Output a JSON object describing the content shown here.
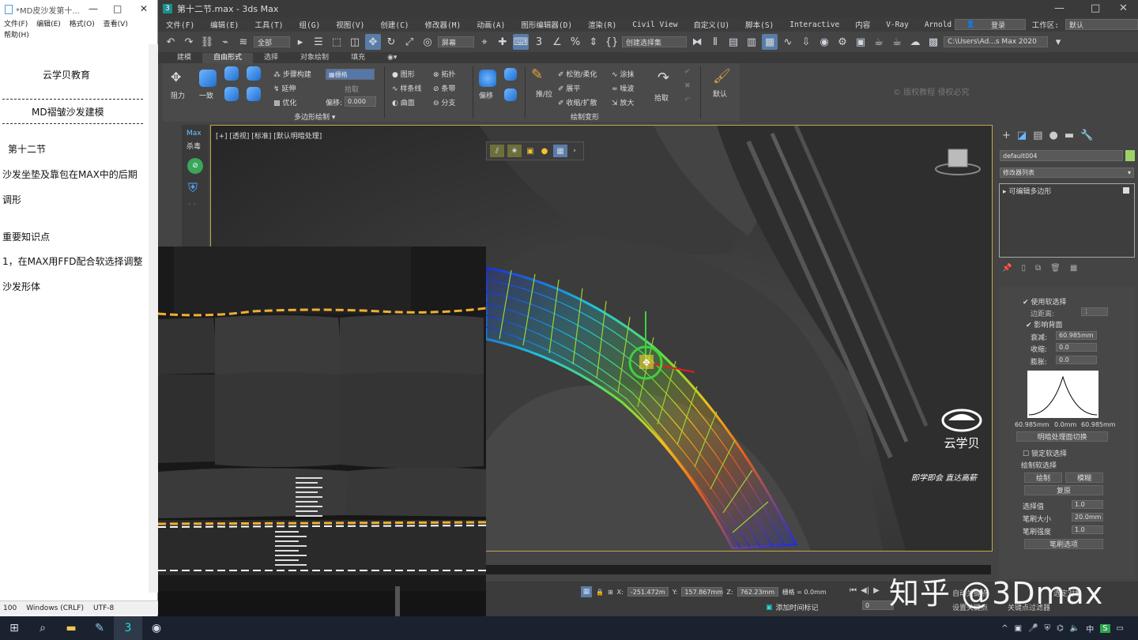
{
  "notepad": {
    "title": "*MD皮沙发第十...",
    "menu": [
      "文件(F)",
      "编辑(E)",
      "格式(O)",
      "查看(V)",
      "帮助(H)"
    ],
    "lines": {
      "org": "云学贝教育",
      "course": "MD褶皱沙发建模",
      "chapter": "第十二节",
      "topic_1": "沙发坐垫及靠包在MAX中的后期",
      "topic_2": "调形",
      "key_points": "重要知识点",
      "point_1a": "1，在MAX用FFD配合软选择调整",
      "point_1b": "沙发形体"
    },
    "status": {
      "pos": "100",
      "eol": "Windows (CRLF)",
      "enc": "UTF-8"
    }
  },
  "max": {
    "title": "第十二节.max - 3ds Max",
    "menu": [
      "文件(F)",
      "编辑(E)",
      "工具(T)",
      "组(G)",
      "视图(V)",
      "创建(C)",
      "修改器(M)",
      "动画(A)",
      "图形编辑器(D)",
      "渲染(R)",
      "Civil View",
      "自定义(U)",
      "脚本(S)",
      "Interactive",
      "内容",
      "V-Ray",
      "Arnold"
    ],
    "login": "登录",
    "workspace_label": "工作区:",
    "workspace_value": "默认",
    "toolbar": {
      "filter": "全部",
      "view": "屏幕",
      "selection_set": "创建选择集",
      "path": "C:\\Users\\Ad...s Max 2020"
    },
    "ribbon_tabs": [
      "建模",
      "自由形式",
      "选择",
      "对象绘制",
      "填充"
    ],
    "ribbon_active_tab": "自由形式",
    "ribbon": {
      "drag": "阻力",
      "conform": "一致",
      "step_build": "步骤构建",
      "extend": "延伸",
      "optimize": "优化",
      "grid": "栅格",
      "pick": "拾取",
      "offset_label": "偏移:",
      "offset_value": "0.000",
      "shape": "图形",
      "spline": "样条线",
      "surface": "曲面",
      "topology": "拓扑",
      "strips": "条带",
      "branch": "分支",
      "panel_polydraw": "多边形绘制",
      "shift": "偏移",
      "push_pull": "推/拉",
      "relax": "松弛/柔化",
      "flatten": "展平",
      "pinch_spread": "收缩/扩散",
      "smudge": "涂抹",
      "noise": "噪波",
      "exaggerate": "放大",
      "pick2": "拾取",
      "default": "默认",
      "panel_paintdeform": "绘制变形",
      "watermark": "版权教程 侵权必究"
    },
    "left_strip": {
      "max": "Max",
      "antivirus": "杀毒"
    },
    "viewport": {
      "label": "[+] [透视] [标准] [默认明暗处理]",
      "brand_name": "云学贝",
      "slogan": "即学即会 直达高薪"
    },
    "command_panel": {
      "object_name": "default004",
      "object_color": "#9bd36a",
      "modifier_list": "修改器列表",
      "stack_item": "可编辑多边形",
      "use_soft_selection": "使用软选择",
      "edge_distance": "边距离:",
      "edge_distance_value": "1",
      "affect_backfacing": "影响背面",
      "falloff_label": "衰减:",
      "falloff_value": "60.985mm",
      "pinch_label": "收缩:",
      "pinch_value": "0.0",
      "bubble_label": "膨胀:",
      "bubble_value": "0.0",
      "curve_left": "60.985mm",
      "curve_mid": "0.0mm",
      "curve_right": "60.985mm",
      "shaded_face_toggle": "明暗处理面切换",
      "lock_soft_selection": "锁定软选择",
      "paint_soft_selection": "绘制软选择",
      "paint": "绘制",
      "blur": "模糊",
      "revert": "复原",
      "selection_value_label": "选择值",
      "selection_value": "1.0",
      "brush_size_label": "笔刷大小",
      "brush_size": "20.0mm",
      "brush_strength_label": "笔刷强度",
      "brush_strength": "1.0",
      "brush_options": "笔刷选项"
    },
    "status": {
      "x_label": "X:",
      "x_value": "-251.472m",
      "y_label": "Y:",
      "y_value": "157.867mm",
      "z_label": "Z:",
      "z_value": "762.23mm",
      "grid": "栅格 = 0.0mm",
      "add_time_tag": "添加时间标记",
      "auto_key": "自动关键点",
      "set_key": "设置关键点",
      "key_filters": "关键点过滤器",
      "selected": "选定对象",
      "frame": "0"
    }
  },
  "watermark_zhihu": "知乎 @3Dmax",
  "taskbar": {
    "ime": "中",
    "ime2": "S"
  },
  "colors": {
    "accent": "#5a7da8",
    "viewport_border": "#c9a54a",
    "selection_green": "#3ed13e"
  }
}
